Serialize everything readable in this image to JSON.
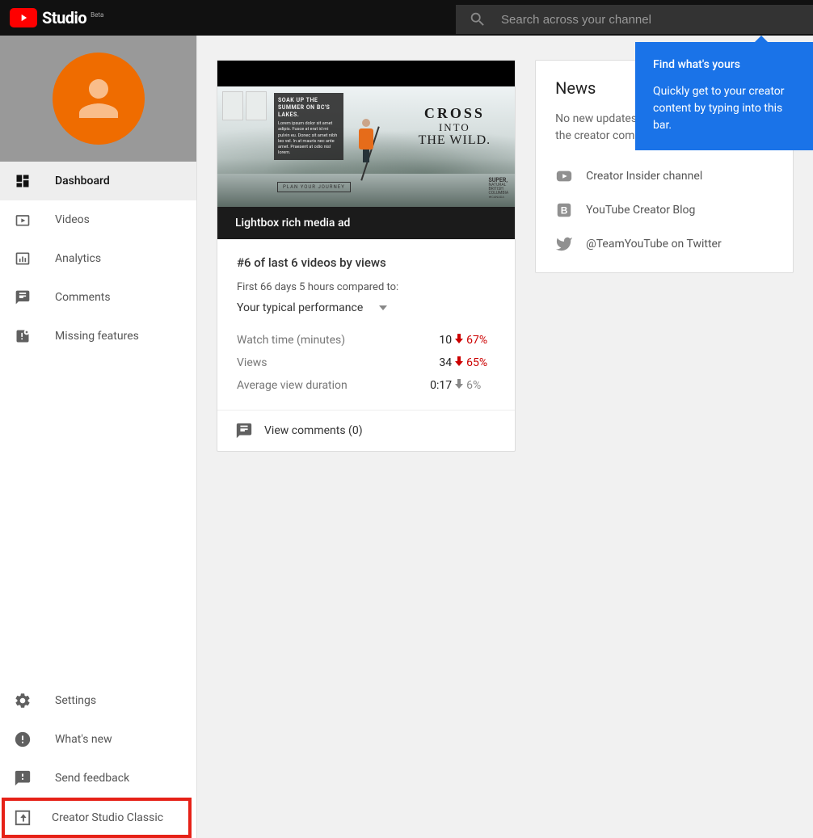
{
  "header": {
    "logo_word": "Studio",
    "logo_badge": "Beta",
    "search_placeholder": "Search across your channel"
  },
  "sidebar": {
    "main": [
      {
        "label": "Dashboard"
      },
      {
        "label": "Videos"
      },
      {
        "label": "Analytics"
      },
      {
        "label": "Comments"
      },
      {
        "label": "Missing features"
      }
    ],
    "bottom": [
      {
        "label": "Settings"
      },
      {
        "label": "What's new"
      },
      {
        "label": "Send feedback"
      },
      {
        "label": "Creator Studio Classic"
      }
    ]
  },
  "video_card": {
    "thumb": {
      "overlay_title": "SOAK UP THE SUMMER ON BC'S LAKES.",
      "cross_l1": "CROSS",
      "cross_l2": "INTO",
      "cross_l3": "THE WILD.",
      "cta": "PLAN YOUR JOURNEY",
      "brand": "SUPER, NATURAL BRITISH COLUMBIA CANADA"
    },
    "title": "Lightbox rich media ad",
    "rank": "#6 of last 6 videos by views",
    "compare": "First 66 days 5 hours compared to:",
    "perf_selector": "Your typical performance",
    "metrics": [
      {
        "label": "Watch time (minutes)",
        "value": "10",
        "dir": "down",
        "perc": "67%"
      },
      {
        "label": "Views",
        "value": "34",
        "dir": "down",
        "perc": "65%"
      },
      {
        "label": "Average view duration",
        "value": "0:17",
        "dir": "neutral",
        "perc": "6%"
      }
    ],
    "comments_link": "View comments (0)"
  },
  "news": {
    "heading": "News",
    "body": "No new updates or announcements from the creator community.",
    "links": [
      "Creator Insider channel",
      "YouTube Creator Blog",
      "@TeamYouTube on Twitter"
    ]
  },
  "popover": {
    "title": "Find what's yours",
    "body": "Quickly get to your creator content by typing into this bar."
  }
}
